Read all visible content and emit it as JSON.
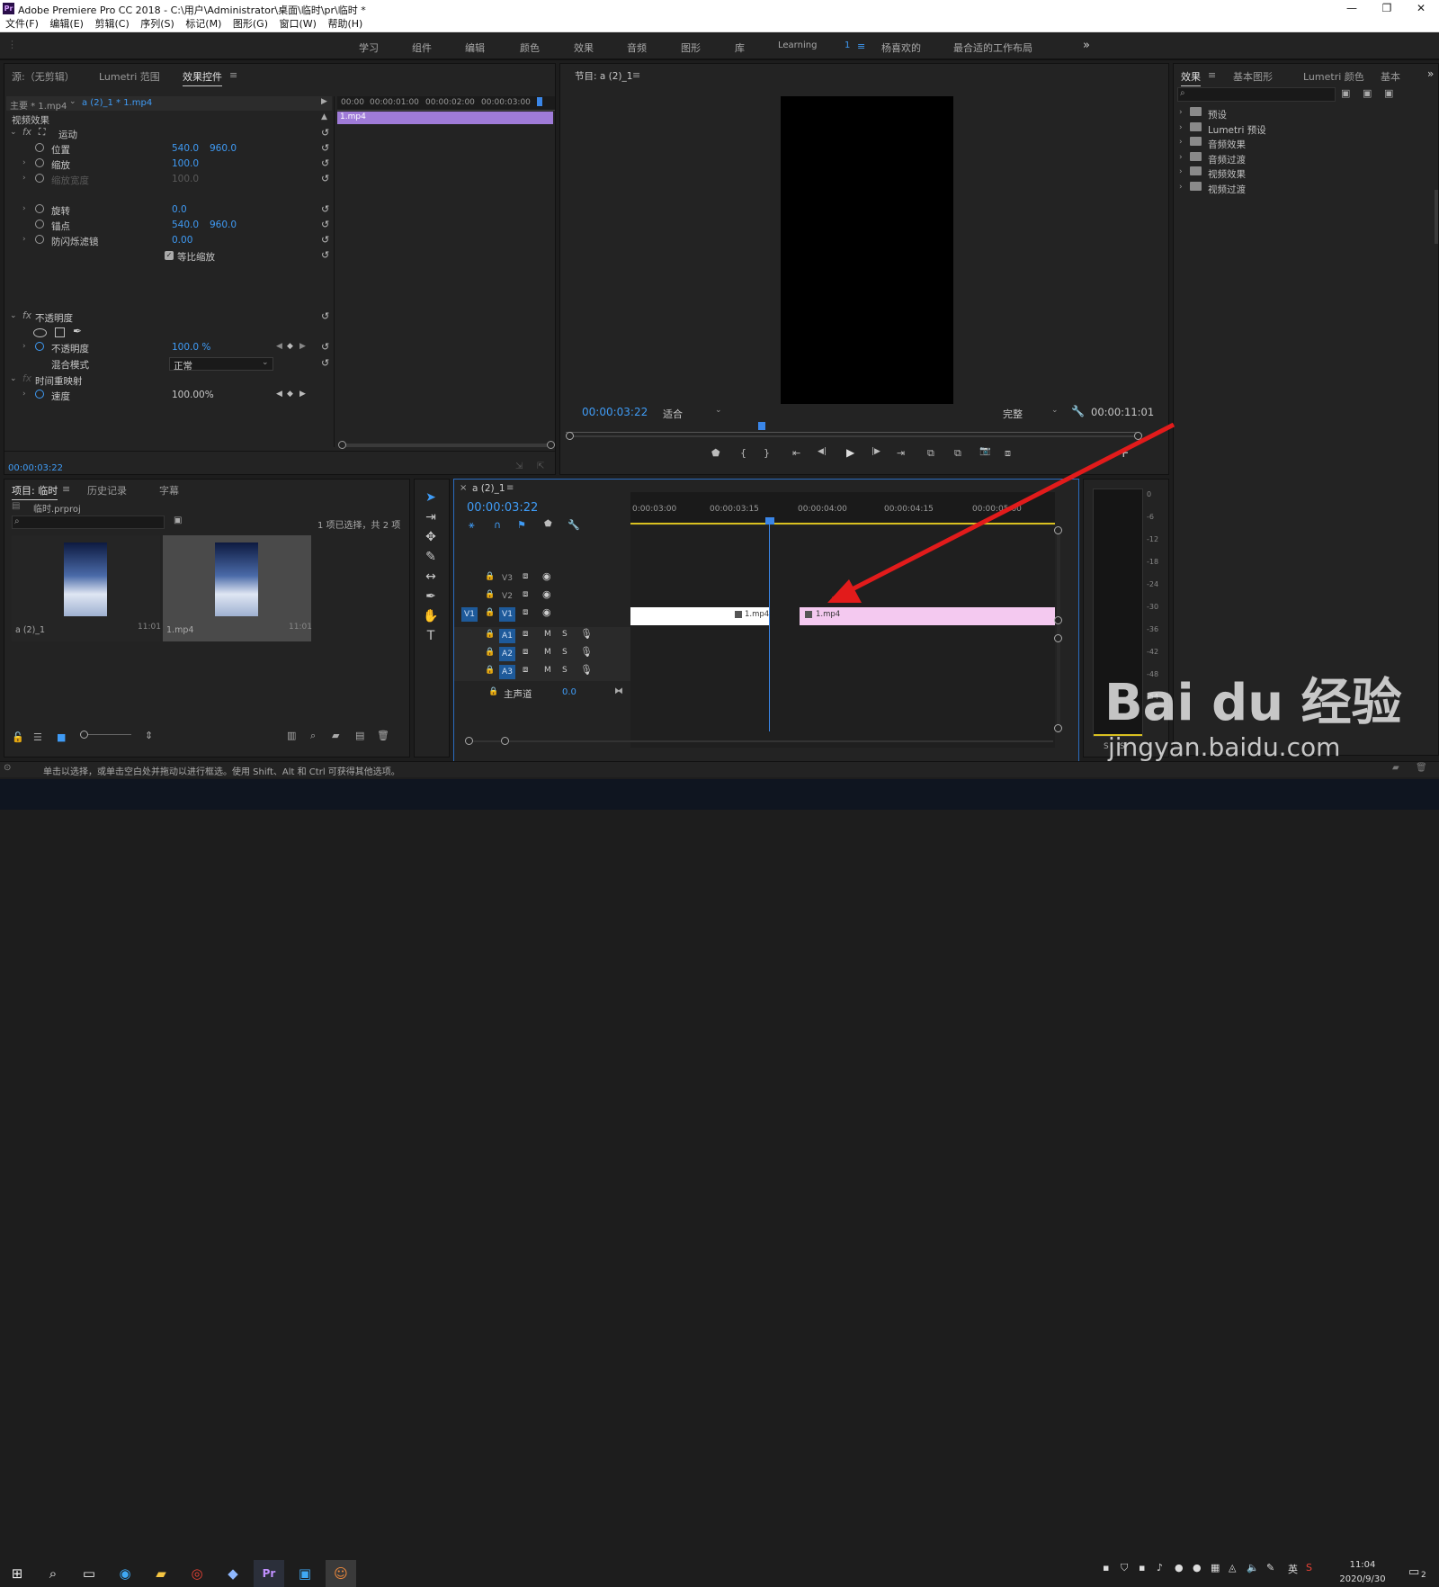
{
  "window": {
    "title": "Adobe Premiere Pro CC 2018 - C:\\用户\\Administrator\\桌面\\临时\\pr\\临时 *",
    "app_icon": "Pr",
    "controls": [
      "—",
      "❐",
      "✕"
    ]
  },
  "menu": [
    "文件(F)",
    "编辑(E)",
    "剪辑(C)",
    "序列(S)",
    "标记(M)",
    "图形(G)",
    "窗口(W)",
    "帮助(H)"
  ],
  "workspaces": {
    "items": [
      "学习",
      "组件",
      "编辑",
      "颜色",
      "效果",
      "音频",
      "图形",
      "库",
      "Learning",
      "1",
      "杨喜欢的",
      "最合适的工作布局"
    ],
    "more": "»",
    "menu_icon": "≡"
  },
  "effect_controls": {
    "tabs": [
      "源:（无剪辑）",
      "Lumetri 范围",
      "效果控件"
    ],
    "menu_icon": "≡",
    "master": "主要 * 1.mp4",
    "clip": "a (2)_1 * 1.mp4",
    "video_effects": "视频效果",
    "motion": "运动",
    "props": [
      {
        "label": "位置",
        "v1": "540.0",
        "v2": "960.0",
        "arrow": "",
        "dim": false
      },
      {
        "label": "缩放",
        "v1": "100.0",
        "v2": "",
        "arrow": "›",
        "dim": false
      },
      {
        "label": "缩放宽度",
        "v1": "100.0",
        "v2": "",
        "arrow": "›",
        "dim": true
      },
      {
        "label": "旋转",
        "v1": "0.0",
        "v2": "",
        "arrow": "›",
        "dim": false
      },
      {
        "label": "锚点",
        "v1": "540.0",
        "v2": "960.0",
        "arrow": "",
        "dim": false
      },
      {
        "label": "防闪烁滤镜",
        "v1": "0.00",
        "v2": "",
        "arrow": "›",
        "dim": false
      }
    ],
    "uniform_scale": "等比缩放",
    "opacity_group": "不透明度",
    "opacity": {
      "label": "不透明度",
      "value": "100.0 %"
    },
    "blend": {
      "label": "混合模式",
      "value": "正常"
    },
    "time_remap": "时间重映射",
    "speed": {
      "label": "速度",
      "value": "100.00%"
    },
    "ruler": [
      "00:00",
      "00:00:01:00",
      "00:00:02:00",
      "00:00:03:00"
    ],
    "clip_bar": "1.mp4",
    "timecode": "00:00:03:22"
  },
  "program": {
    "title": "节目: a (2)_1",
    "menu_icon": "≡",
    "timecode": "00:00:03:22",
    "fit": "适合",
    "quality": "完整",
    "duration": "00:00:11:01",
    "transport": [
      "⬟",
      "{",
      "}",
      "⇤",
      "◀|",
      "▶",
      "|▶",
      "⇥",
      "⧉",
      "⧉",
      "📷",
      "⧈"
    ],
    "add": "+"
  },
  "effects": {
    "tabs": [
      "效果",
      "基本图形",
      "Lumetri 颜色",
      "基本"
    ],
    "menu_icon": "≡",
    "more": "»",
    "folders": [
      "预设",
      "Lumetri 预设",
      "音频效果",
      "音频过渡",
      "视频效果",
      "视频过渡"
    ]
  },
  "project": {
    "tabs": [
      "项目: 临时",
      "历史记录",
      "字幕"
    ],
    "menu_icon": "≡",
    "file": "临时.prproj",
    "selection": "1 项已选择，共 2 项",
    "items": [
      {
        "name": "a (2)_1",
        "duration": "11:01"
      },
      {
        "name": "1.mp4",
        "duration": "11:01"
      }
    ]
  },
  "timeline": {
    "tab": "a (2)_1",
    "close": "×",
    "menu_icon": "≡",
    "timecode": "00:00:03:22",
    "ruler": [
      "0:00:03:00",
      "00:00:03:15",
      "00:00:04:00",
      "00:00:04:15",
      "00:00:05:00"
    ],
    "tracks": [
      {
        "src": "",
        "name": "V3",
        "kind": "video"
      },
      {
        "src": "",
        "name": "V2",
        "kind": "video"
      },
      {
        "src": "V1",
        "name": "V1",
        "kind": "video"
      },
      {
        "src": "",
        "name": "A1",
        "kind": "audio"
      },
      {
        "src": "",
        "name": "A2",
        "kind": "audio"
      },
      {
        "src": "",
        "name": "A3",
        "kind": "audio"
      }
    ],
    "master_label": "主声道",
    "master_value": "0.0",
    "clips": [
      "1.mp4",
      "1.mp4"
    ],
    "mute": "M",
    "solo": "S"
  },
  "audio_meter": {
    "scale": [
      "0",
      "-6",
      "-12",
      "-18",
      "-24",
      "-30",
      "-36",
      "-42",
      "-48",
      "-54"
    ],
    "solo": "S",
    "solo2": "S"
  },
  "status": {
    "text": "单击以选择，或单击空白处并拖动以进行框选。使用 Shift、Alt 和 Ctrl 可获得其他选项。"
  },
  "taskbar": {
    "time": "11:04",
    "date": "2020/9/30",
    "ime": "英",
    "notif": "2"
  },
  "watermark": {
    "brand": "Bai du 经验",
    "url": "jingyan.baidu.com"
  },
  "colors": {
    "accent": "#3f9bf5",
    "clip_purple": "#9f7bd8",
    "clip_pink": "#f4c9f0",
    "arrow": "#e21b1b",
    "timeline_border": "#2a6cbf",
    "playhead": "#3a86e8"
  }
}
